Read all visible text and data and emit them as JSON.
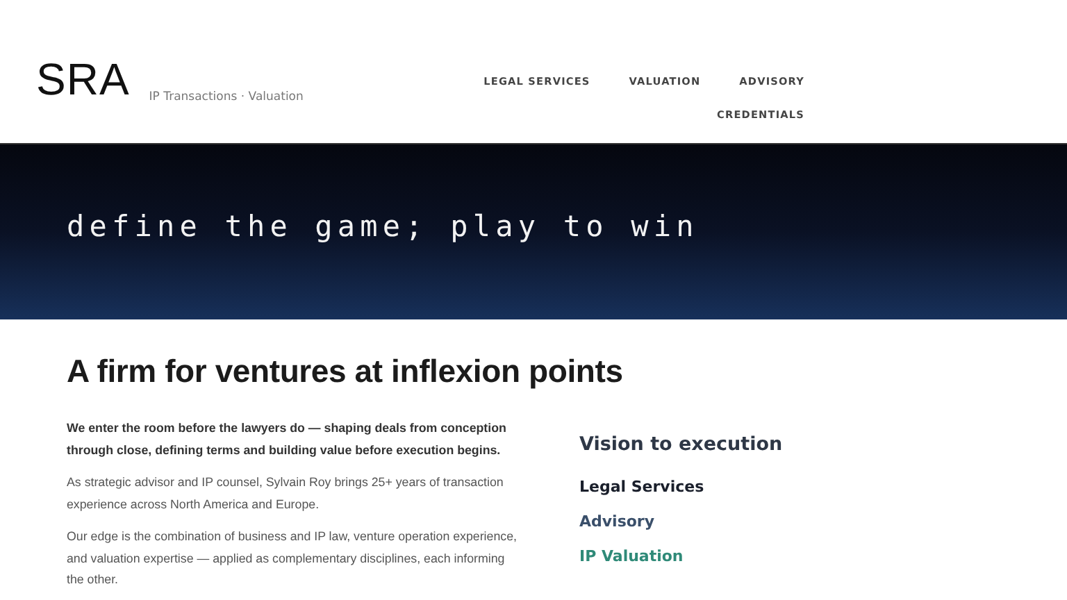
{
  "header": {
    "logo": "SRA",
    "tagline": "IP Transactions · Valuation",
    "nav": [
      "LEGAL SERVICES",
      "VALUATION",
      "ADVISORY",
      "CREDENTIALS"
    ]
  },
  "hero": {
    "title": "define the game; play to win"
  },
  "intro": {
    "heading": "A firm for ventures at inflexion points",
    "paragraphs": [
      {
        "kind": "lead",
        "text": "We enter the room before the lawyers do — shaping deals from conception through close, defining terms and building value before execution begins."
      },
      {
        "kind": "body",
        "text": "As strategic advisor and IP counsel, Sylvain Roy brings 25+ years of transaction experience across North America and Europe."
      },
      {
        "kind": "body",
        "text": "Our edge is the combination of business and IP law, venture operation experience, and valuation expertise — applied as complementary disciplines, each informing the other."
      }
    ]
  },
  "aside": {
    "heading": "Vision to execution",
    "links": [
      {
        "label": "Legal Services",
        "color": "#1a1f2b"
      },
      {
        "label": "Advisory",
        "color": "#3a4f6a"
      },
      {
        "label": "IP Valuation",
        "color": "#2f8a78"
      }
    ]
  }
}
